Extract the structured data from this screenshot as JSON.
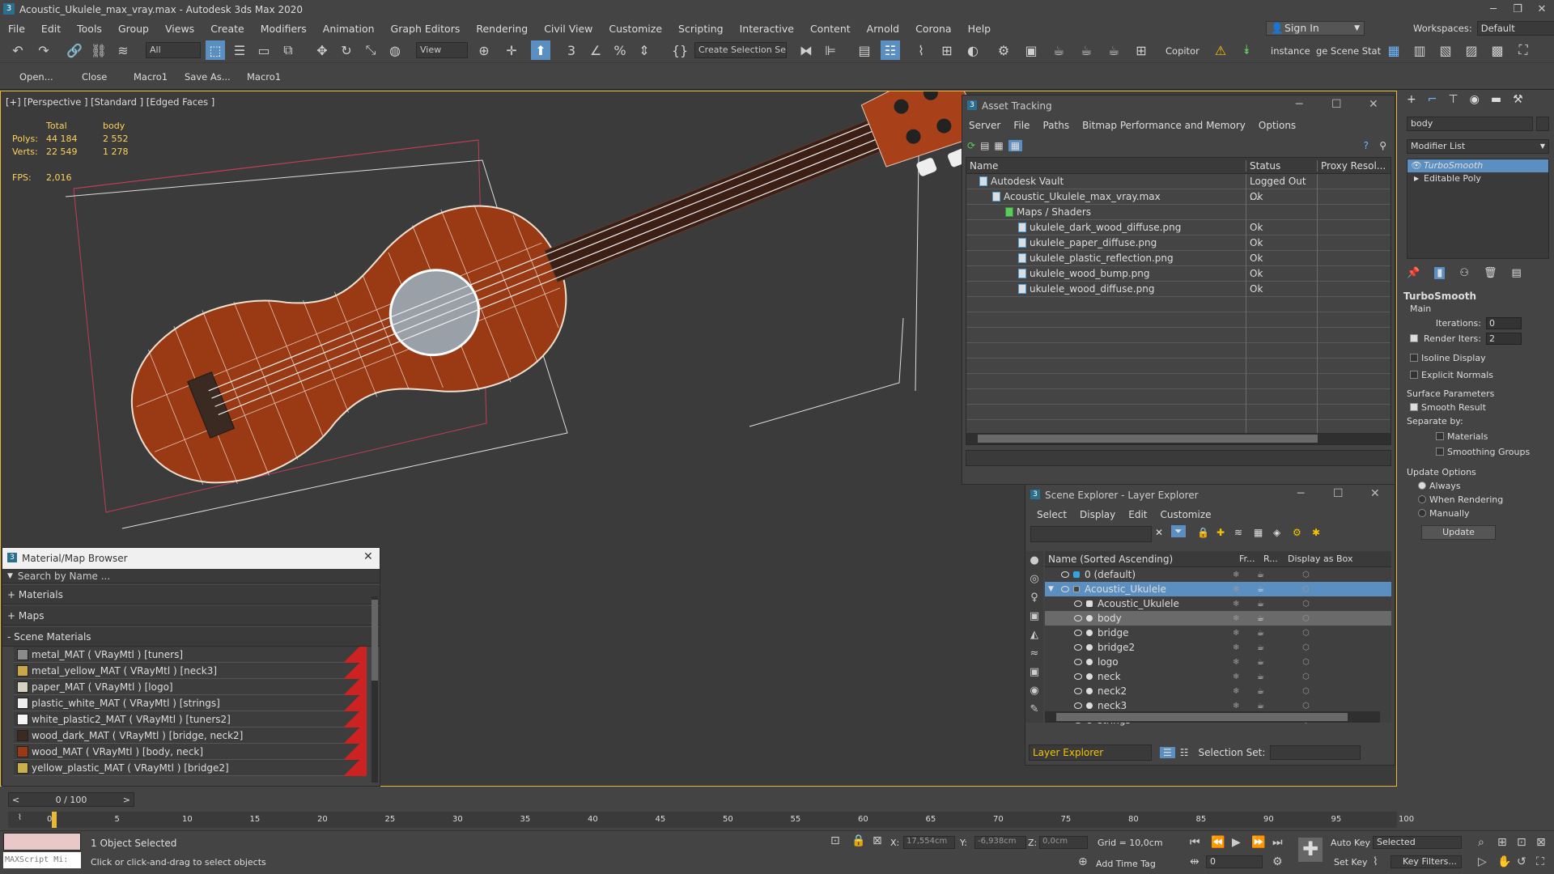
{
  "title": "Acoustic_Ukulele_max_vray.max - Autodesk 3ds Max 2020",
  "menu": [
    "File",
    "Edit",
    "Tools",
    "Group",
    "Views",
    "Create",
    "Modifiers",
    "Animation",
    "Graph Editors",
    "Rendering",
    "Civil View",
    "Customize",
    "Scripting",
    "Interactive",
    "Content",
    "Arnold",
    "Corona",
    "Help"
  ],
  "signin": "Sign In",
  "workspace": {
    "label": "Workspaces:",
    "value": "Default"
  },
  "toolbar": {
    "filter": "All",
    "refcoord": "View",
    "selset": "Create Selection Se",
    "copitor": "Copitor",
    "instance": "instance",
    "scenestate": "ge Scene Stat"
  },
  "macros": [
    "Open...",
    "Close",
    "Macro1",
    "Save As...",
    "Macro1"
  ],
  "viewport": {
    "label": "[+] [Perspective ] [Standard ] [Edged Faces ]",
    "stats": {
      "h_total": "Total",
      "h_obj": "body",
      "polys_label": "Polys:",
      "polys_total": "44 184",
      "polys_obj": "2 552",
      "verts_label": "Verts:",
      "verts_total": "22 549",
      "verts_obj": "1 278",
      "fps_label": "FPS:",
      "fps": "2,016"
    }
  },
  "asset_tracking": {
    "title": "Asset Tracking",
    "menu": [
      "Server",
      "File",
      "Paths",
      "Bitmap Performance and Memory",
      "Options"
    ],
    "columns": [
      "Name",
      "Status",
      "Proxy Resol..."
    ],
    "rows": [
      {
        "name": "Autodesk Vault",
        "status": "Logged Out ...",
        "indent": 1
      },
      {
        "name": "Acoustic_Ukulele_max_vray.max",
        "status": "Ok",
        "indent": 2
      },
      {
        "name": "Maps / Shaders",
        "status": "",
        "indent": 3
      },
      {
        "name": "ukulele_dark_wood_diffuse.png",
        "status": "Ok",
        "indent": 4
      },
      {
        "name": "ukulele_paper_diffuse.png",
        "status": "Ok",
        "indent": 4
      },
      {
        "name": "ukulele_plastic_reflection.png",
        "status": "Ok",
        "indent": 4
      },
      {
        "name": "ukulele_wood_bump.png",
        "status": "Ok",
        "indent": 4
      },
      {
        "name": "ukulele_wood_diffuse.png",
        "status": "Ok",
        "indent": 4
      }
    ]
  },
  "material_browser": {
    "title": "Material/Map Browser",
    "search_placeholder": "Search by Name ...",
    "sections": [
      "+ Materials",
      "+ Maps",
      "- Scene Materials"
    ],
    "materials": [
      "metal_MAT  ( VRayMtl )  [tuners]",
      "metal_yellow_MAT  ( VRayMtl )  [neck3]",
      "paper_MAT  ( VRayMtl )  [logo]",
      "plastic_white_MAT  ( VRayMtl )  [strings]",
      "white_plastic2_MAT  ( VRayMtl )  [tuners2]",
      "wood_dark_MAT  ( VRayMtl )  [bridge, neck2]",
      "wood_MAT  ( VRayMtl )  [body, neck]",
      "yellow_plastic_MAT  ( VRayMtl )  [bridge2]"
    ]
  },
  "scene_explorer": {
    "title": "Scene Explorer - Layer Explorer",
    "menu": [
      "Select",
      "Display",
      "Edit",
      "Customize"
    ],
    "columns": [
      "Name (Sorted Ascending)",
      "Fr...",
      "R...",
      "Display as Box"
    ],
    "rows": [
      {
        "name": "0 (default)",
        "level": 0
      },
      {
        "name": "Acoustic_Ukulele",
        "level": 0
      },
      {
        "name": "Acoustic_Ukulele",
        "level": 1
      },
      {
        "name": "body",
        "level": 1
      },
      {
        "name": "bridge",
        "level": 1
      },
      {
        "name": "bridge2",
        "level": 1
      },
      {
        "name": "logo",
        "level": 1
      },
      {
        "name": "neck",
        "level": 1
      },
      {
        "name": "neck2",
        "level": 1
      },
      {
        "name": "neck3",
        "level": 1
      },
      {
        "name": "strings",
        "level": 1
      }
    ],
    "footer_layer": "Layer Explorer",
    "footer_selset": "Selection Set:"
  },
  "command_panel": {
    "name_value": "body",
    "modifier_list": "Modifier List",
    "stack": [
      "TurboSmooth",
      "Editable Poly"
    ],
    "rollout": "TurboSmooth",
    "main": "Main",
    "iterations_label": "Iterations:",
    "iterations": "0",
    "render_iters_label": "Render Iters:",
    "render_iters": "2",
    "isoline": "Isoline Display",
    "explicit": "Explicit Normals",
    "surface": "Surface Parameters",
    "smooth_result": "Smooth Result",
    "separate": "Separate by:",
    "materials": "Materials",
    "smoothing": "Smoothing Groups",
    "update_options": "Update Options",
    "always": "Always",
    "when_rendering": "When Rendering",
    "manually": "Manually",
    "update": "Update"
  },
  "timeline": {
    "frame": "0 / 100",
    "ticks": [
      "0",
      "5",
      "10",
      "15",
      "20",
      "25",
      "30",
      "35",
      "40",
      "45",
      "50",
      "55",
      "60",
      "65",
      "70",
      "75",
      "80",
      "85",
      "90",
      "95",
      "100"
    ]
  },
  "status": {
    "maxscript": "MAXScript Mi:",
    "selected": "1 Object Selected",
    "hint": "Click or click-and-drag to select objects",
    "x_label": "X:",
    "x": "17,554cm",
    "y_label": "Y:",
    "y": "-6,938cm",
    "z_label": "Z:",
    "z": "0,0cm",
    "grid": "Grid = 10,0cm",
    "add_time_tag": "Add Time Tag",
    "autokey": "Auto Key",
    "autokey_sel": "Selected",
    "setkey": "Set Key",
    "keyfilters": "Key Filters...",
    "frame": "0"
  },
  "colors": {
    "accent": "#5b8fc2",
    "viewport_border": "#e8b838",
    "wood": "#9a3a14",
    "stats": "#ffd35a"
  }
}
